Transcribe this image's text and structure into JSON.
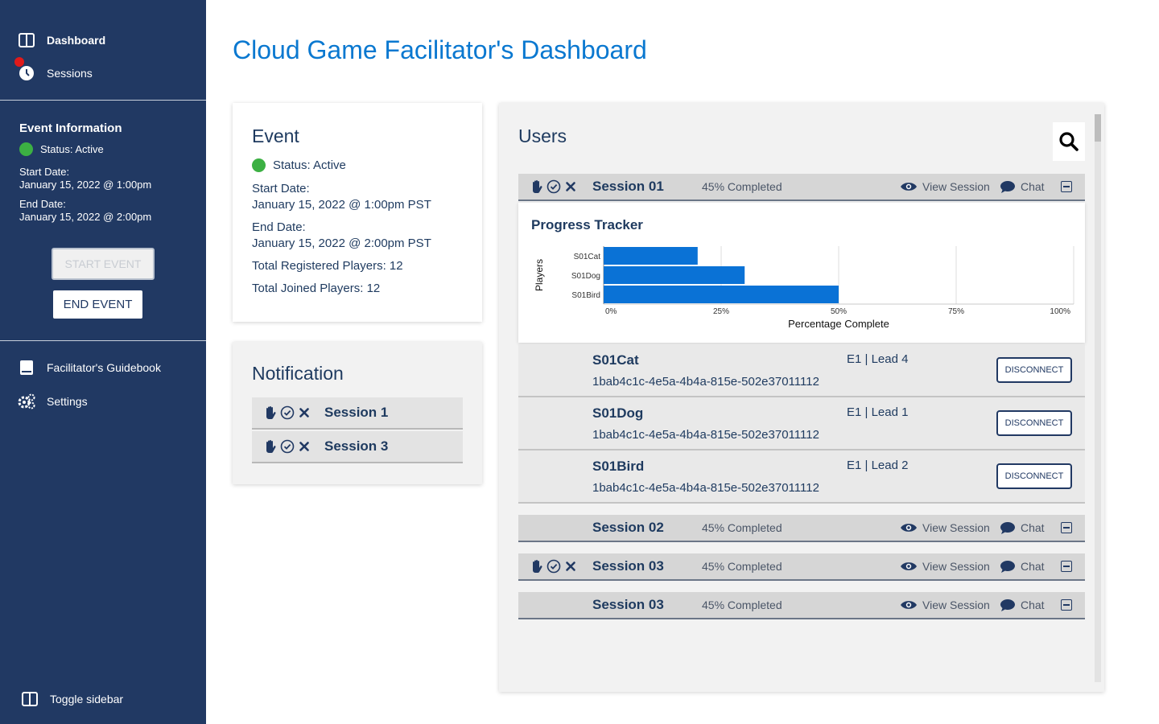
{
  "sidebar": {
    "nav": [
      {
        "label": "Dashboard",
        "icon": "layout-icon"
      },
      {
        "label": "Sessions",
        "icon": "clock-icon"
      }
    ],
    "event_info": {
      "title": "Event Information",
      "status": "Status: Active",
      "start_label": "Start Date:",
      "start_value": "January 15, 2022 @ 1:00pm",
      "end_label": "End Date:",
      "end_value": "January 15, 2022 @ 2:00pm"
    },
    "start_button": "START EVENT",
    "end_button": "END EVENT",
    "bottom_nav": [
      {
        "label": "Facilitator's Guidebook",
        "icon": "book-icon"
      },
      {
        "label": "Settings",
        "icon": "gears-icon"
      }
    ],
    "toggle": "Toggle sidebar"
  },
  "page_title": "Cloud Game Facilitator's Dashboard",
  "event_card": {
    "title": "Event",
    "status": "Status: Active",
    "start_label": "Start Date:",
    "start_value": "January 15, 2022 @ 1:00pm PST",
    "end_label": "End Date:",
    "end_value": "January 15, 2022 @ 2:00pm PST",
    "registered": "Total Registered Players: 12",
    "joined": "Total Joined Players: 12"
  },
  "notification": {
    "title": "Notification",
    "items": [
      "Session 1",
      "Session 3"
    ]
  },
  "users": {
    "title": "Users",
    "view_label": "View Session",
    "chat_label": "Chat",
    "sessions": [
      {
        "name": "Session 01",
        "progress": "45% Completed"
      },
      {
        "name": "Session 02",
        "progress": "45% Completed"
      },
      {
        "name": "Session 03",
        "progress": "45% Completed"
      },
      {
        "name": "Session 03",
        "progress": "45% Completed"
      }
    ],
    "players": [
      {
        "name": "S01Cat",
        "id": "1bab4c1c-4e5a-4b4a-815e-502e37011112",
        "lead": "E1 | Lead 4"
      },
      {
        "name": "S01Dog",
        "id": "1bab4c1c-4e5a-4b4a-815e-502e37011112",
        "lead": "E1 | Lead 1"
      },
      {
        "name": "S01Bird",
        "id": "1bab4c1c-4e5a-4b4a-815e-502e37011112",
        "lead": "E1 | Lead 2"
      }
    ],
    "disconnect_label": "DISCONNECT"
  },
  "progress_tracker": {
    "title": "Progress Tracker"
  },
  "chart_data": {
    "type": "bar",
    "orientation": "horizontal",
    "categories": [
      "S01Cat",
      "S01Dog",
      "S01Bird"
    ],
    "values": [
      20,
      30,
      50
    ],
    "xlabel": "Percentage Complete",
    "ylabel": "Players",
    "xlim": [
      0,
      100
    ],
    "xticks": [
      "0%",
      "25%",
      "50%",
      "75%",
      "100%"
    ],
    "grid": true,
    "bar_color": "#0a72d6"
  },
  "colors": {
    "sidebar": "#213963",
    "accent": "#0a78d0",
    "status_active": "#3cb043",
    "alert": "#e01a1a"
  }
}
